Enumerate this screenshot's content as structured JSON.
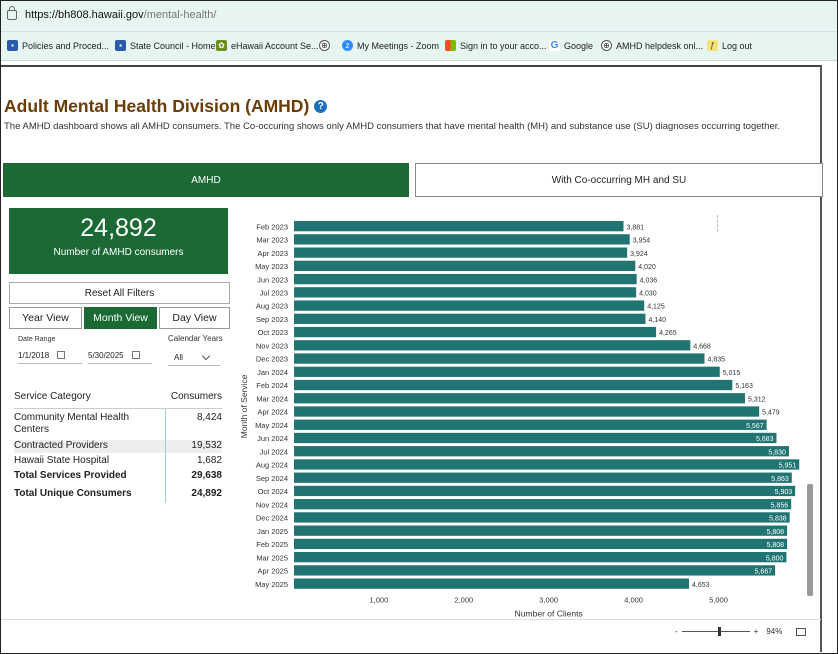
{
  "browser": {
    "url_host": "https://bh808.hawaii.gov",
    "url_path": "/mental-health/",
    "bookmarks": [
      "Policies and Proced...",
      "State Council - Home",
      "eHawaii Account Se...",
      "",
      "My Meetings - Zoom",
      "Sign in to your acco...",
      "Google",
      "AMHD helpdesk onl...",
      "Log out"
    ]
  },
  "page": {
    "title": "Adult Mental Health Division (AMHD)",
    "help": "?",
    "subtitle": "The AMHD dashboard shows all AMHD consumers. The Co-occuring shows only AMHD consumers that have mental health (MH) and substance use (SU) diagnoses occurring together."
  },
  "tabs": {
    "amhd": "AMHD",
    "co": "With Co-occurring MH and SU"
  },
  "kpi": {
    "value": "24,892",
    "label": "Number of AMHD consumers"
  },
  "controls": {
    "reset": "Reset All Filters",
    "year_view": "Year View",
    "month_view": "Month View",
    "day_view": "Day View",
    "date_range_label": "Date Range",
    "date_start": "1/1/2018",
    "date_end": "5/30/2025",
    "calendar_years_label": "Calendar Years",
    "calendar_years_value": "All"
  },
  "table": {
    "col1": "Service Category",
    "col2": "Consumers",
    "rows": [
      {
        "cat": "Community Mental Health Centers",
        "val": "8,424"
      },
      {
        "cat": "Contracted Providers",
        "val": "19,532"
      },
      {
        "cat": "Hawaii State Hospital",
        "val": "1,682"
      }
    ],
    "total_services_label": "Total Services Provided",
    "total_services_value": "29,638",
    "total_unique_label": "Total Unique Consumers",
    "total_unique_value": "24,892"
  },
  "chart_data": {
    "type": "bar",
    "orientation": "horizontal",
    "ylabel": "Month of Service",
    "xlabel": "Number of Clients",
    "x_ticks": [
      "1,000",
      "2,000",
      "3,000",
      "4,000",
      "5,000"
    ],
    "xlim": [
      0,
      6000
    ],
    "bar_color": "#207472",
    "categories": [
      "Feb 2023",
      "Mar 2023",
      "Apr 2023",
      "May 2023",
      "Jun 2023",
      "Jul 2023",
      "Aug 2023",
      "Sep 2023",
      "Oct 2023",
      "Nov 2023",
      "Dec 2023",
      "Jan 2024",
      "Feb 2024",
      "Mar 2024",
      "Apr 2024",
      "May 2024",
      "Jun 2024",
      "Jul 2024",
      "Aug 2024",
      "Sep 2024",
      "Oct 2024",
      "Nov 2024",
      "Dec 2024",
      "Jan 2025",
      "Feb 2025",
      "Mar 2025",
      "Apr 2025",
      "May 2025"
    ],
    "values": [
      3881,
      3954,
      3924,
      4020,
      4036,
      4030,
      4125,
      4140,
      4265,
      4668,
      4835,
      5015,
      5163,
      5312,
      5479,
      5567,
      5683,
      5830,
      5951,
      5863,
      5903,
      5856,
      5838,
      5808,
      5808,
      5800,
      5667,
      4653
    ],
    "labels": [
      "3,881",
      "3,954",
      "3,924",
      "4,020",
      "4,036",
      "4,030",
      "4,125",
      "4,140",
      "4,265",
      "4,668",
      "4,835",
      "5,015",
      "5,163",
      "5,312",
      "5,479",
      "5,567",
      "5,683",
      "5,830",
      "5,951",
      "5,863",
      "5,903",
      "5,856",
      "5,838",
      "5,808",
      "5,808",
      "5,800",
      "5,667",
      "4,653"
    ]
  },
  "status": {
    "zoom": "94%",
    "minus": "-",
    "plus": "+"
  }
}
